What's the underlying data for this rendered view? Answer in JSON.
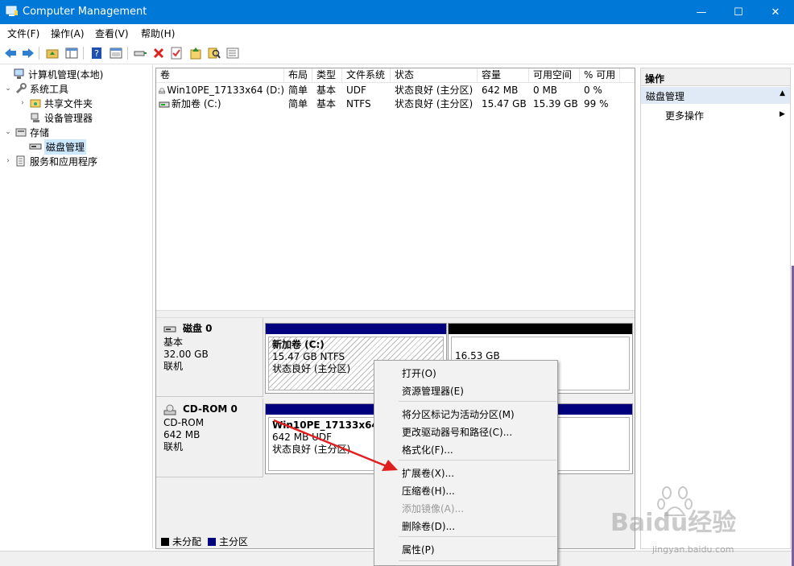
{
  "window": {
    "title": "Computer Management",
    "min_glyph": "—",
    "max_glyph": "☐",
    "close_glyph": "✕"
  },
  "menu": [
    "文件(F)",
    "操作(A)",
    "查看(V)",
    "帮助(H)"
  ],
  "tree": {
    "root": "计算机管理(本地)",
    "system_tools": "系统工具",
    "shared_folders": "共享文件夹",
    "device_manager": "设备管理器",
    "storage": "存储",
    "disk_management": "磁盘管理",
    "services": "服务和应用程序"
  },
  "volume_list": {
    "columns": [
      "卷",
      "布局",
      "类型",
      "文件系统",
      "状态",
      "容量",
      "可用空间",
      "% 可用"
    ],
    "rows": [
      [
        "Win10PE_17133x64 (D:)",
        "简单",
        "基本",
        "UDF",
        "状态良好 (主分区)",
        "642 MB",
        "0 MB",
        "0 %"
      ],
      [
        "新加卷 (C:)",
        "简单",
        "基本",
        "NTFS",
        "状态良好 (主分区)",
        "15.47 GB",
        "15.39 GB",
        "99 %"
      ]
    ]
  },
  "disks": [
    {
      "name": "磁盘 0",
      "kind": "基本",
      "size": "32.00 GB",
      "state": "联机",
      "partitions": [
        {
          "title": "新加卷 (C:)",
          "line2": "15.47 GB NTFS",
          "line3": "状态良好 (主分区)"
        },
        {
          "title": "",
          "line2": "16.53 GB",
          "line3": ""
        }
      ]
    },
    {
      "name": "CD-ROM 0",
      "kind": "CD-ROM",
      "size": "642 MB",
      "state": "联机",
      "partitions": [
        {
          "title": "Win10PE_17133x64",
          "line2": "642 MB UDF",
          "line3": "状态良好 (主分区)"
        }
      ]
    }
  ],
  "legend": {
    "unallocated": "未分配",
    "primary": "主分区"
  },
  "actions": {
    "header": "操作",
    "section": "磁盘管理",
    "more": "更多操作"
  },
  "context_menu": {
    "open": "打开(O)",
    "explore": "资源管理器(E)",
    "mark_active": "将分区标记为活动分区(M)",
    "change_letter": "更改驱动器号和路径(C)...",
    "format": "格式化(F)...",
    "extend": "扩展卷(X)...",
    "shrink": "压缩卷(H)...",
    "add_mirror": "添加镜像(A)...",
    "delete": "删除卷(D)...",
    "properties": "属性(P)"
  },
  "watermark": {
    "brand": "Baidu经验",
    "url": "jingyan.baidu.com"
  },
  "colors": {
    "titlebar": "#0078d7",
    "primary_partition": "#00007f",
    "unallocated": "#000000",
    "annotation_arrow": "#e02020"
  }
}
